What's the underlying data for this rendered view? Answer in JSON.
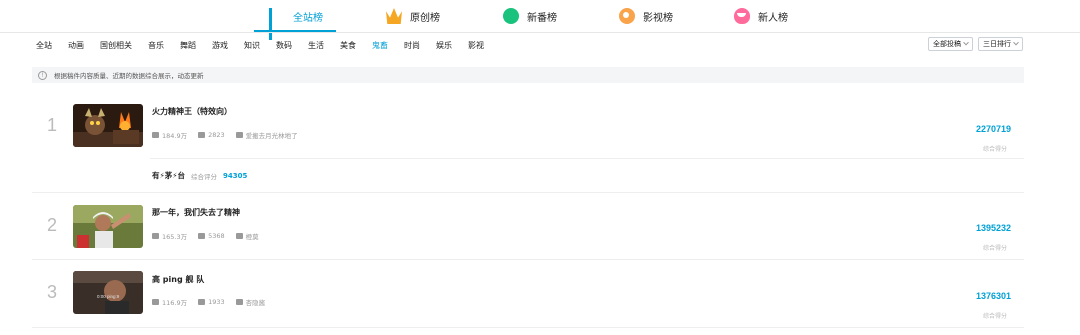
{
  "rank_tabs": [
    {
      "label": "全站榜",
      "icon": "bar-chart-icon",
      "active": true
    },
    {
      "label": "原创榜",
      "icon": "crown-icon"
    },
    {
      "label": "新番榜",
      "icon": "circle-icon"
    },
    {
      "label": "影视榜",
      "icon": "film-reel-icon"
    },
    {
      "label": "新人榜",
      "icon": "face-icon"
    }
  ],
  "categories": [
    "全站",
    "动画",
    "国创相关",
    "音乐",
    "舞蹈",
    "游戏",
    "知识",
    "数码",
    "生活",
    "美食",
    "鬼畜",
    "时尚",
    "娱乐",
    "影视"
  ],
  "active_category": "鬼畜",
  "filters": {
    "submission": "全部投稿",
    "period": "三日排行"
  },
  "notice": "根据稿件内容质量、近期的数据综合展示，动态更新",
  "score_label": "综合得分",
  "rows": [
    {
      "rank": "1",
      "title": "火力精神王（特效向）",
      "plays": "184.9万",
      "danmaku": "2823",
      "author": "爱搬去月光林地了",
      "score": "2270719",
      "extra": {
        "name": "有⚡茅⚡台",
        "label": "综合评分",
        "value": "94305"
      }
    },
    {
      "rank": "2",
      "title": "那一年，我们失去了精神",
      "plays": "165.3万",
      "danmaku": "5368",
      "author": "橙莫",
      "score": "1395232"
    },
    {
      "rank": "3",
      "title": "高 ping 舰 队",
      "plays": "116.9万",
      "danmaku": "1933",
      "author": "杏隐酱",
      "score": "1376301",
      "thumb_text": "0:00 ping:9"
    }
  ],
  "colors": {
    "accent": "#00a1d6",
    "gray": "#999999"
  }
}
